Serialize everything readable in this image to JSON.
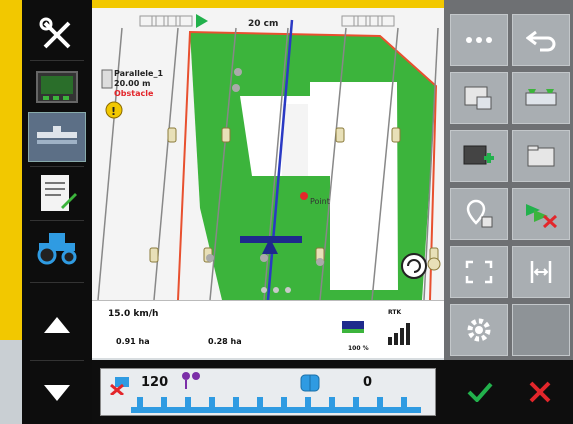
{
  "map": {
    "spacing_label": "20 cm",
    "line_name": "Parallele_1",
    "line_width": "20.00 m",
    "obstacle_label": "Obstacle",
    "point_label": "Point"
  },
  "info": {
    "speed": "15.0 km/h",
    "area_left": "0.91 ha",
    "area_right": "0.28 ha",
    "gnss_label": "RTK",
    "percent": "100 %"
  },
  "boom": {
    "rate": "120",
    "right_value": "0"
  },
  "colors": {
    "field_green": "#3cb43c",
    "boundary_red": "#e8502f",
    "guidance_blue": "#2a39c4",
    "boom_blue": "#2f9be2",
    "ok_green": "#22b14c",
    "cancel_red": "#e3262b",
    "accent_yellow": "#f2c800"
  },
  "icons": {
    "sidebar": [
      "wrench-screwdriver-icon",
      "display-icon",
      "implement-icon",
      "task-notepad-icon",
      "tractor-icon",
      "arrow-up-icon",
      "arrow-down-icon"
    ],
    "right_panel": [
      "ellipsis-icon",
      "back-arrow-icon",
      "map-view-icon",
      "field-overview-icon",
      "add-boundary-icon",
      "folder-icon",
      "location-pin-icon",
      "delete-guidance-icon",
      "fullscreen-icon",
      "parallel-lines-icon",
      "settings-gear-icon"
    ],
    "bottom": [
      "check-icon",
      "close-icon"
    ]
  }
}
